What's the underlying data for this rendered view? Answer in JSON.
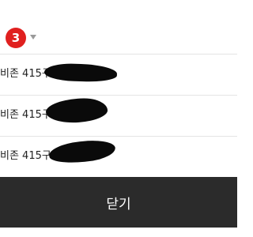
{
  "header": {
    "count": "3",
    "dropdown_icon": "caret-down-icon",
    "badge_color": "#e0201f"
  },
  "list": {
    "items": [
      {
        "label": "비존 415구역"
      },
      {
        "label": "비존 415구역"
      },
      {
        "label": "비존 415구역"
      }
    ]
  },
  "footer": {
    "close_label": "닫기",
    "background_color": "#2b2b2b"
  }
}
